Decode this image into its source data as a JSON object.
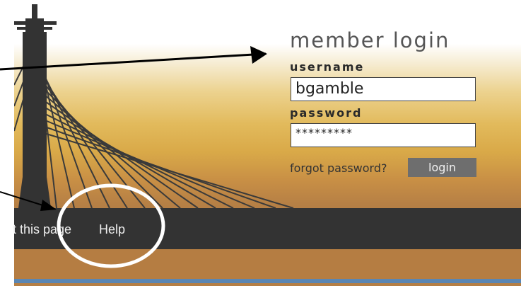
{
  "login": {
    "title": "member login",
    "username_label": "username",
    "username_value": "bgamble",
    "password_label": "password",
    "password_value": "*********",
    "forgot_label": "forgot password?",
    "login_label": "login"
  },
  "nav": {
    "items": [
      "t this page",
      "Help"
    ]
  }
}
